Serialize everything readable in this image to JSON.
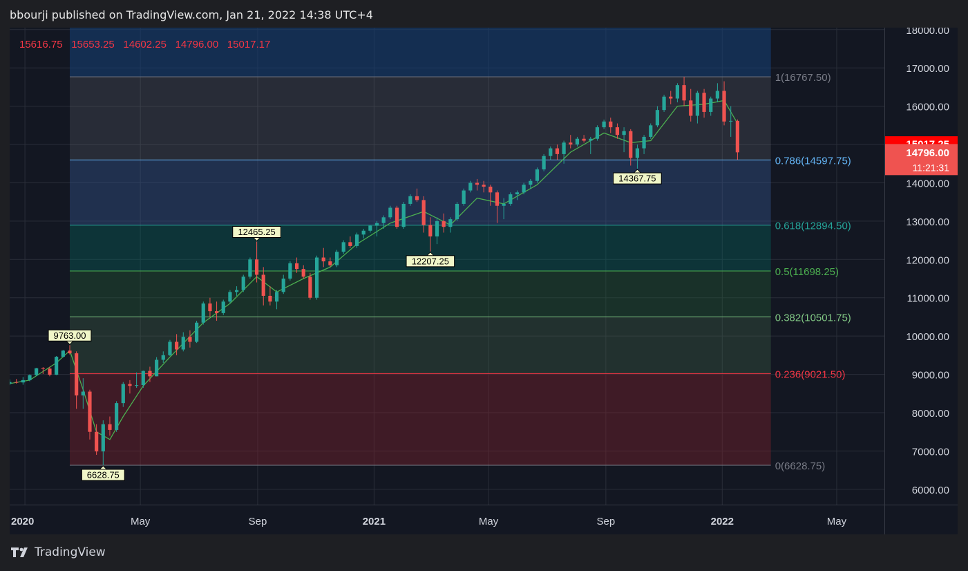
{
  "header": {
    "publish_line": "bbourji published on TradingView.com, Jan 21, 2022 14:38 UTC+4"
  },
  "footer": {
    "brand": "TradingView"
  },
  "ohlc_readout": [
    "15616.75",
    "15653.25",
    "14602.25",
    "14796.00",
    "15017.17"
  ],
  "price_badges": {
    "ma_value": "15017.25",
    "last_price": "14796.00",
    "countdown": "11:21:31"
  },
  "colors": {
    "up": "#26a69a",
    "down": "#ef5350",
    "ma": "#4caf50",
    "grid": "#2a2e39",
    "axis_text": "#d1d4dc",
    "background": "#131722"
  },
  "chart_data": {
    "type": "candlestick",
    "x_axis": {
      "tick_labels": [
        "2020",
        "May",
        "Sep",
        "2021",
        "May",
        "Sep",
        "2022",
        "May"
      ],
      "tick_dates": [
        "2020-01-01",
        "2020-05-01",
        "2020-09-01",
        "2021-01-01",
        "2021-05-01",
        "2021-09-01",
        "2022-01-01",
        "2022-05-01"
      ],
      "range": [
        "2019-12-16",
        "2022-06-20"
      ]
    },
    "y_axis": {
      "tick_labels": [
        "6000.00",
        "7000.00",
        "8000.00",
        "9000.00",
        "10000.00",
        "11000.00",
        "12000.00",
        "13000.00",
        "14000.00",
        "15000.00",
        "16000.00",
        "17000.00",
        "18000.00"
      ],
      "range": [
        5600,
        18050
      ]
    },
    "fibonacci": {
      "start_date": "2020-02-17",
      "end_date": "2022-02-21",
      "levels": [
        {
          "label": "1(16767.50)",
          "price": 16767.5,
          "color": "#787b86"
        },
        {
          "label": "0.786(14597.75)",
          "price": 14597.75,
          "color": "#64b5f6"
        },
        {
          "label": "0.618(12894.50)",
          "price": 12894.5,
          "color": "#26a69a"
        },
        {
          "label": "0.5(11698.25)",
          "price": 11698.25,
          "color": "#4caf50"
        },
        {
          "label": "0.382(10501.75)",
          "price": 10501.75,
          "color": "#81c784"
        },
        {
          "label": "0.236(9021.50)",
          "price": 9021.5,
          "color": "#f23645"
        },
        {
          "label": "0(6628.75)",
          "price": 6628.75,
          "color": "#787b86"
        }
      ]
    },
    "pivot_labels": [
      {
        "text": "9763.00",
        "date": "2020-02-17",
        "price": 9763.0,
        "position": "above"
      },
      {
        "text": "6628.75",
        "date": "2020-03-23",
        "price": 6628.75,
        "position": "below"
      },
      {
        "text": "12465.25",
        "date": "2020-08-31",
        "price": 12465.25,
        "position": "above"
      },
      {
        "text": "12207.25",
        "date": "2021-03-01",
        "price": 12207.25,
        "position": "below"
      },
      {
        "text": "14367.75",
        "date": "2021-10-04",
        "price": 14367.75,
        "position": "below"
      }
    ],
    "candles": [
      {
        "d": "2019-12-16",
        "o": 8760,
        "h": 8870,
        "l": 8720,
        "c": 8800
      },
      {
        "d": "2019-12-23",
        "o": 8800,
        "h": 8880,
        "l": 8760,
        "c": 8790
      },
      {
        "d": "2019-12-30",
        "o": 8790,
        "h": 8930,
        "l": 8730,
        "c": 8850
      },
      {
        "d": "2020-01-06",
        "o": 8850,
        "h": 9000,
        "l": 8820,
        "c": 8980
      },
      {
        "d": "2020-01-13",
        "o": 8980,
        "h": 9170,
        "l": 8960,
        "c": 9160
      },
      {
        "d": "2020-01-20",
        "o": 9160,
        "h": 9190,
        "l": 9010,
        "c": 9150
      },
      {
        "d": "2020-01-27",
        "o": 9150,
        "h": 9200,
        "l": 8950,
        "c": 8990
      },
      {
        "d": "2020-02-03",
        "o": 8990,
        "h": 9480,
        "l": 8980,
        "c": 9460
      },
      {
        "d": "2020-02-10",
        "o": 9460,
        "h": 9640,
        "l": 9440,
        "c": 9620
      },
      {
        "d": "2020-02-17",
        "o": 9620,
        "h": 9763,
        "l": 9520,
        "c": 9550
      },
      {
        "d": "2020-02-24",
        "o": 9550,
        "h": 9600,
        "l": 8100,
        "c": 8450
      },
      {
        "d": "2020-03-02",
        "o": 8450,
        "h": 8900,
        "l": 8100,
        "c": 8550
      },
      {
        "d": "2020-03-09",
        "o": 8550,
        "h": 8600,
        "l": 7300,
        "c": 7500
      },
      {
        "d": "2020-03-16",
        "o": 7500,
        "h": 7700,
        "l": 6900,
        "c": 6990
      },
      {
        "d": "2020-03-23",
        "o": 6990,
        "h": 7800,
        "l": 6628.75,
        "c": 7700
      },
      {
        "d": "2020-03-30",
        "o": 7700,
        "h": 7900,
        "l": 7400,
        "c": 7550
      },
      {
        "d": "2020-04-06",
        "o": 7550,
        "h": 8300,
        "l": 7500,
        "c": 8250
      },
      {
        "d": "2020-04-13",
        "o": 8250,
        "h": 8800,
        "l": 8150,
        "c": 8750
      },
      {
        "d": "2020-04-20",
        "o": 8750,
        "h": 8850,
        "l": 8500,
        "c": 8700
      },
      {
        "d": "2020-04-27",
        "o": 8700,
        "h": 9050,
        "l": 8650,
        "c": 8720
      },
      {
        "d": "2020-05-04",
        "o": 8720,
        "h": 9100,
        "l": 8650,
        "c": 9090
      },
      {
        "d": "2020-05-11",
        "o": 9090,
        "h": 9200,
        "l": 8800,
        "c": 8950
      },
      {
        "d": "2020-05-18",
        "o": 8950,
        "h": 9450,
        "l": 8950,
        "c": 9380
      },
      {
        "d": "2020-05-25",
        "o": 9380,
        "h": 9600,
        "l": 9300,
        "c": 9500
      },
      {
        "d": "2020-06-01",
        "o": 9500,
        "h": 9900,
        "l": 9480,
        "c": 9850
      },
      {
        "d": "2020-06-08",
        "o": 9850,
        "h": 10050,
        "l": 9500,
        "c": 9650
      },
      {
        "d": "2020-06-15",
        "o": 9650,
        "h": 10100,
        "l": 9600,
        "c": 9980
      },
      {
        "d": "2020-06-22",
        "o": 9980,
        "h": 10150,
        "l": 9700,
        "c": 9850
      },
      {
        "d": "2020-06-29",
        "o": 9850,
        "h": 10400,
        "l": 9820,
        "c": 10350
      },
      {
        "d": "2020-07-06",
        "o": 10350,
        "h": 10900,
        "l": 10300,
        "c": 10850
      },
      {
        "d": "2020-07-13",
        "o": 10850,
        "h": 11000,
        "l": 10500,
        "c": 10650
      },
      {
        "d": "2020-07-20",
        "o": 10650,
        "h": 10900,
        "l": 10400,
        "c": 10600
      },
      {
        "d": "2020-07-27",
        "o": 10600,
        "h": 10950,
        "l": 10550,
        "c": 10900
      },
      {
        "d": "2020-08-03",
        "o": 10900,
        "h": 11200,
        "l": 10850,
        "c": 11150
      },
      {
        "d": "2020-08-10",
        "o": 11150,
        "h": 11300,
        "l": 11050,
        "c": 11200
      },
      {
        "d": "2020-08-17",
        "o": 11200,
        "h": 11600,
        "l": 11150,
        "c": 11550
      },
      {
        "d": "2020-08-24",
        "o": 11550,
        "h": 12050,
        "l": 11500,
        "c": 12000
      },
      {
        "d": "2020-08-31",
        "o": 12000,
        "h": 12465.25,
        "l": 11400,
        "c": 11600
      },
      {
        "d": "2020-09-07",
        "o": 11600,
        "h": 11800,
        "l": 10800,
        "c": 11050
      },
      {
        "d": "2020-09-14",
        "o": 11050,
        "h": 11300,
        "l": 10800,
        "c": 10900
      },
      {
        "d": "2020-09-21",
        "o": 10900,
        "h": 11200,
        "l": 10700,
        "c": 11150
      },
      {
        "d": "2020-09-28",
        "o": 11150,
        "h": 11600,
        "l": 11100,
        "c": 11500
      },
      {
        "d": "2020-10-05",
        "o": 11500,
        "h": 11950,
        "l": 11450,
        "c": 11900
      },
      {
        "d": "2020-10-12",
        "o": 11900,
        "h": 12050,
        "l": 11650,
        "c": 11750
      },
      {
        "d": "2020-10-19",
        "o": 11750,
        "h": 11850,
        "l": 11500,
        "c": 11550
      },
      {
        "d": "2020-10-26",
        "o": 11550,
        "h": 11650,
        "l": 10950,
        "c": 11000
      },
      {
        "d": "2020-11-02",
        "o": 11000,
        "h": 12100,
        "l": 10950,
        "c": 12050
      },
      {
        "d": "2020-11-09",
        "o": 12050,
        "h": 12300,
        "l": 11800,
        "c": 11950
      },
      {
        "d": "2020-11-16",
        "o": 11950,
        "h": 12050,
        "l": 11800,
        "c": 11850
      },
      {
        "d": "2020-11-23",
        "o": 11850,
        "h": 12250,
        "l": 11800,
        "c": 12200
      },
      {
        "d": "2020-11-30",
        "o": 12200,
        "h": 12500,
        "l": 12150,
        "c": 12450
      },
      {
        "d": "2020-12-07",
        "o": 12450,
        "h": 12600,
        "l": 12300,
        "c": 12350
      },
      {
        "d": "2020-12-14",
        "o": 12350,
        "h": 12700,
        "l": 12300,
        "c": 12650
      },
      {
        "d": "2020-12-21",
        "o": 12650,
        "h": 12800,
        "l": 12550,
        "c": 12750
      },
      {
        "d": "2020-12-28",
        "o": 12750,
        "h": 12900,
        "l": 12700,
        "c": 12880
      },
      {
        "d": "2021-01-04",
        "o": 12880,
        "h": 13000,
        "l": 12600,
        "c": 12950
      },
      {
        "d": "2021-01-11",
        "o": 12950,
        "h": 13150,
        "l": 12800,
        "c": 13100
      },
      {
        "d": "2021-01-18",
        "o": 13100,
        "h": 13400,
        "l": 13050,
        "c": 13350
      },
      {
        "d": "2021-01-25",
        "o": 13350,
        "h": 13400,
        "l": 12800,
        "c": 12850
      },
      {
        "d": "2021-02-01",
        "o": 12850,
        "h": 13500,
        "l": 12800,
        "c": 13450
      },
      {
        "d": "2021-02-08",
        "o": 13450,
        "h": 13700,
        "l": 13400,
        "c": 13650
      },
      {
        "d": "2021-02-15",
        "o": 13650,
        "h": 13850,
        "l": 13500,
        "c": 13550
      },
      {
        "d": "2021-02-22",
        "o": 13550,
        "h": 13650,
        "l": 12700,
        "c": 12900
      },
      {
        "d": "2021-03-01",
        "o": 12900,
        "h": 13100,
        "l": 12207.25,
        "c": 12600
      },
      {
        "d": "2021-03-08",
        "o": 12600,
        "h": 13100,
        "l": 12400,
        "c": 13000
      },
      {
        "d": "2021-03-15",
        "o": 13000,
        "h": 13200,
        "l": 12700,
        "c": 12850
      },
      {
        "d": "2021-03-22",
        "o": 12850,
        "h": 13100,
        "l": 12700,
        "c": 13050
      },
      {
        "d": "2021-03-29",
        "o": 13050,
        "h": 13500,
        "l": 13000,
        "c": 13450
      },
      {
        "d": "2021-04-05",
        "o": 13450,
        "h": 13850,
        "l": 13400,
        "c": 13800
      },
      {
        "d": "2021-04-12",
        "o": 13800,
        "h": 14050,
        "l": 13750,
        "c": 14000
      },
      {
        "d": "2021-04-19",
        "o": 14000,
        "h": 14100,
        "l": 13800,
        "c": 13950
      },
      {
        "d": "2021-04-26",
        "o": 13950,
        "h": 14050,
        "l": 13750,
        "c": 13900
      },
      {
        "d": "2021-05-03",
        "o": 13900,
        "h": 13950,
        "l": 13400,
        "c": 13750
      },
      {
        "d": "2021-05-10",
        "o": 13750,
        "h": 13800,
        "l": 12950,
        "c": 13400
      },
      {
        "d": "2021-05-17",
        "o": 13400,
        "h": 13600,
        "l": 13050,
        "c": 13450
      },
      {
        "d": "2021-05-24",
        "o": 13450,
        "h": 13750,
        "l": 13400,
        "c": 13700
      },
      {
        "d": "2021-05-31",
        "o": 13700,
        "h": 13800,
        "l": 13550,
        "c": 13750
      },
      {
        "d": "2021-06-07",
        "o": 13750,
        "h": 14000,
        "l": 13700,
        "c": 13950
      },
      {
        "d": "2021-06-14",
        "o": 13950,
        "h": 14100,
        "l": 13850,
        "c": 14050
      },
      {
        "d": "2021-06-21",
        "o": 14050,
        "h": 14400,
        "l": 14000,
        "c": 14350
      },
      {
        "d": "2021-06-28",
        "o": 14350,
        "h": 14750,
        "l": 14300,
        "c": 14700
      },
      {
        "d": "2021-07-05",
        "o": 14700,
        "h": 14950,
        "l": 14600,
        "c": 14900
      },
      {
        "d": "2021-07-12",
        "o": 14900,
        "h": 15000,
        "l": 14600,
        "c": 14750
      },
      {
        "d": "2021-07-19",
        "o": 14750,
        "h": 15100,
        "l": 14500,
        "c": 15050
      },
      {
        "d": "2021-07-26",
        "o": 15050,
        "h": 15250,
        "l": 14900,
        "c": 15000
      },
      {
        "d": "2021-08-02",
        "o": 15000,
        "h": 15200,
        "l": 14950,
        "c": 15150
      },
      {
        "d": "2021-08-09",
        "o": 15150,
        "h": 15250,
        "l": 15050,
        "c": 15100
      },
      {
        "d": "2021-08-16",
        "o": 15100,
        "h": 15200,
        "l": 14750,
        "c": 15150
      },
      {
        "d": "2021-08-23",
        "o": 15150,
        "h": 15500,
        "l": 15100,
        "c": 15450
      },
      {
        "d": "2021-08-30",
        "o": 15450,
        "h": 15650,
        "l": 15400,
        "c": 15600
      },
      {
        "d": "2021-09-06",
        "o": 15600,
        "h": 15700,
        "l": 15300,
        "c": 15450
      },
      {
        "d": "2021-09-13",
        "o": 15450,
        "h": 15550,
        "l": 15150,
        "c": 15250
      },
      {
        "d": "2021-09-20",
        "o": 15250,
        "h": 15450,
        "l": 14800,
        "c": 15350
      },
      {
        "d": "2021-09-27",
        "o": 15350,
        "h": 15400,
        "l": 14450,
        "c": 14650
      },
      {
        "d": "2021-10-04",
        "o": 14650,
        "h": 15000,
        "l": 14367.75,
        "c": 14900
      },
      {
        "d": "2021-10-11",
        "o": 14900,
        "h": 15250,
        "l": 14750,
        "c": 15200
      },
      {
        "d": "2021-10-18",
        "o": 15200,
        "h": 15550,
        "l": 15150,
        "c": 15500
      },
      {
        "d": "2021-10-25",
        "o": 15500,
        "h": 16000,
        "l": 15450,
        "c": 15900
      },
      {
        "d": "2021-11-01",
        "o": 15900,
        "h": 16300,
        "l": 15850,
        "c": 16250
      },
      {
        "d": "2021-11-08",
        "o": 16250,
        "h": 16400,
        "l": 16050,
        "c": 16200
      },
      {
        "d": "2021-11-15",
        "o": 16200,
        "h": 16600,
        "l": 16100,
        "c": 16550
      },
      {
        "d": "2021-11-22",
        "o": 16550,
        "h": 16767.5,
        "l": 16000,
        "c": 16150
      },
      {
        "d": "2021-11-29",
        "o": 16150,
        "h": 16450,
        "l": 15600,
        "c": 15750
      },
      {
        "d": "2021-12-06",
        "o": 15750,
        "h": 16400,
        "l": 15550,
        "c": 16350
      },
      {
        "d": "2021-12-13",
        "o": 16350,
        "h": 16450,
        "l": 15700,
        "c": 15850
      },
      {
        "d": "2021-12-20",
        "o": 15850,
        "h": 16250,
        "l": 15750,
        "c": 16200
      },
      {
        "d": "2021-12-27",
        "o": 16200,
        "h": 16600,
        "l": 16100,
        "c": 16400
      },
      {
        "d": "2022-01-03",
        "o": 16400,
        "h": 16650,
        "l": 15500,
        "c": 15600
      },
      {
        "d": "2022-01-10",
        "o": 15600,
        "h": 16000,
        "l": 15200,
        "c": 15616.75
      },
      {
        "d": "2022-01-17",
        "o": 15616.75,
        "h": 15653.25,
        "l": 14602.25,
        "c": 14796
      }
    ],
    "moving_average": [
      {
        "d": "2019-12-16",
        "v": 8760
      },
      {
        "d": "2020-01-06",
        "v": 8850
      },
      {
        "d": "2020-02-03",
        "v": 9300
      },
      {
        "d": "2020-02-17",
        "v": 9620
      },
      {
        "d": "2020-03-02",
        "v": 8600
      },
      {
        "d": "2020-03-16",
        "v": 7500
      },
      {
        "d": "2020-03-30",
        "v": 7300
      },
      {
        "d": "2020-04-13",
        "v": 7900
      },
      {
        "d": "2020-05-04",
        "v": 8700
      },
      {
        "d": "2020-06-01",
        "v": 9450
      },
      {
        "d": "2020-07-06",
        "v": 10350
      },
      {
        "d": "2020-08-03",
        "v": 10850
      },
      {
        "d": "2020-08-31",
        "v": 11550
      },
      {
        "d": "2020-09-21",
        "v": 11150
      },
      {
        "d": "2020-10-19",
        "v": 11500
      },
      {
        "d": "2020-11-16",
        "v": 11800
      },
      {
        "d": "2020-12-14",
        "v": 12400
      },
      {
        "d": "2021-01-18",
        "v": 12950
      },
      {
        "d": "2021-02-22",
        "v": 13250
      },
      {
        "d": "2021-03-22",
        "v": 12900
      },
      {
        "d": "2021-04-19",
        "v": 13600
      },
      {
        "d": "2021-05-17",
        "v": 13450
      },
      {
        "d": "2021-06-21",
        "v": 13950
      },
      {
        "d": "2021-07-26",
        "v": 14800
      },
      {
        "d": "2021-08-30",
        "v": 15300
      },
      {
        "d": "2021-09-27",
        "v": 15050
      },
      {
        "d": "2021-10-18",
        "v": 15100
      },
      {
        "d": "2021-11-15",
        "v": 16000
      },
      {
        "d": "2021-12-13",
        "v": 16050
      },
      {
        "d": "2022-01-03",
        "v": 16150
      },
      {
        "d": "2022-01-17",
        "v": 15550
      }
    ]
  }
}
